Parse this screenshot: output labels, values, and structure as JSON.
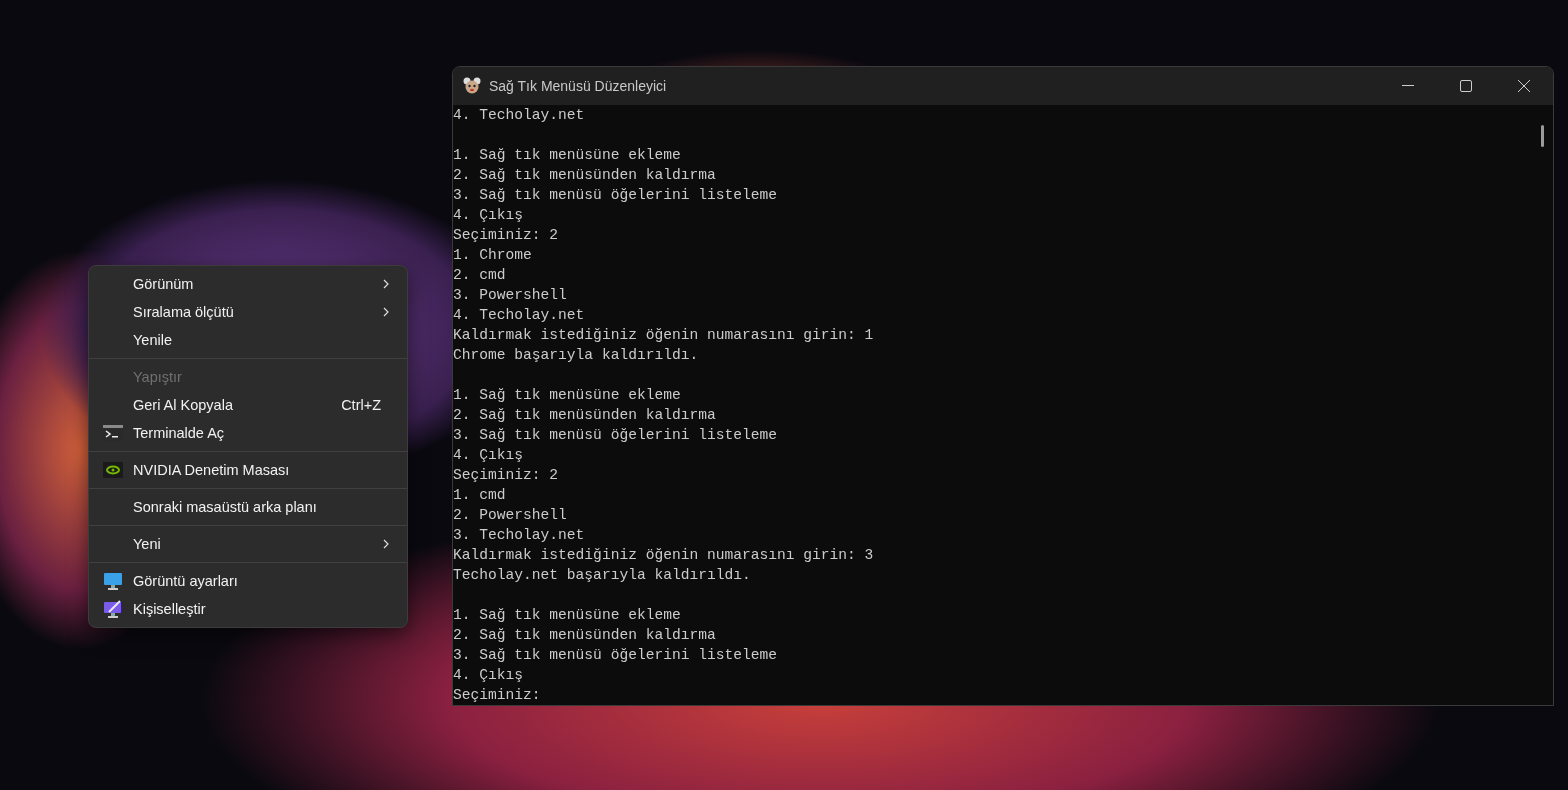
{
  "window": {
    "title": "Sağ Tık Menüsü Düzenleyici"
  },
  "console": {
    "blocks": [
      [
        "4. Techolay.net"
      ],
      [
        "1. Sağ tık menüsüne ekleme",
        "2. Sağ tık menüsünden kaldırma",
        "3. Sağ tık menüsü öğelerini listeleme",
        "4. Çıkış",
        "Seçiminiz: 2",
        "1. Chrome",
        "2. cmd",
        "3. Powershell",
        "4. Techolay.net",
        "Kaldırmak istediğiniz öğenin numarasını girin: 1",
        "Chrome başarıyla kaldırıldı."
      ],
      [
        "1. Sağ tık menüsüne ekleme",
        "2. Sağ tık menüsünden kaldırma",
        "3. Sağ tık menüsü öğelerini listeleme",
        "4. Çıkış",
        "Seçiminiz: 2",
        "1. cmd",
        "2. Powershell",
        "3. Techolay.net",
        "Kaldırmak istediğiniz öğenin numarasını girin: 3",
        "Techolay.net başarıyla kaldırıldı."
      ],
      [
        "1. Sağ tık menüsüne ekleme",
        "2. Sağ tık menüsünden kaldırma",
        "3. Sağ tık menüsü öğelerini listeleme",
        "4. Çıkış",
        "Seçiminiz:"
      ]
    ]
  },
  "context_menu": {
    "groups": [
      [
        {
          "label": "Görünüm",
          "submenu": true,
          "disabled": false
        },
        {
          "label": "Sıralama ölçütü",
          "submenu": true,
          "disabled": false
        },
        {
          "label": "Yenile",
          "submenu": false,
          "disabled": false
        }
      ],
      [
        {
          "label": "Yapıştır",
          "submenu": false,
          "disabled": true
        },
        {
          "label": "Geri Al Kopyala",
          "shortcut": "Ctrl+Z",
          "submenu": false,
          "disabled": false
        },
        {
          "label": "Terminalde Aç",
          "kind": "terminal",
          "submenu": false,
          "disabled": false
        }
      ],
      [
        {
          "label": "NVIDIA Denetim Masası",
          "kind": "nvidia",
          "submenu": false,
          "disabled": false
        }
      ],
      [
        {
          "label": "Sonraki masaüstü arka planı",
          "submenu": false,
          "disabled": false
        }
      ],
      [
        {
          "label": "Yeni",
          "submenu": true,
          "disabled": false
        }
      ],
      [
        {
          "label": "Görüntü ayarları",
          "kind": "display",
          "submenu": false,
          "disabled": false
        },
        {
          "label": "Kişiselleştir",
          "kind": "personalize",
          "submenu": false,
          "disabled": false
        }
      ]
    ]
  }
}
